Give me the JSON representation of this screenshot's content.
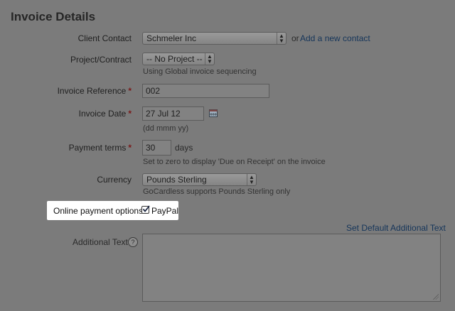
{
  "section": {
    "title": "Invoice Details"
  },
  "client_contact": {
    "label": "Client Contact",
    "value": "Schmeler Inc",
    "or_text": "or",
    "add_link": "Add a new contact"
  },
  "project": {
    "label": "Project/Contract",
    "value": "-- No Project --",
    "hint": "Using Global invoice sequencing"
  },
  "invoice_reference": {
    "label": "Invoice Reference",
    "required_mark": "*",
    "value": "002"
  },
  "invoice_date": {
    "label": "Invoice Date",
    "required_mark": "*",
    "value": "27 Jul 12",
    "hint": "(dd mmm yy)"
  },
  "payment_terms": {
    "label": "Payment terms",
    "required_mark": "*",
    "value": "30",
    "unit": "days",
    "hint": "Set to zero to display 'Due on Receipt' on the invoice"
  },
  "currency": {
    "label": "Currency",
    "value": "Pounds Sterling",
    "hint": "GoCardless supports Pounds Sterling only"
  },
  "online_payment": {
    "label": "Online payment options",
    "option_label": "PayPal",
    "checked": true
  },
  "additional_text": {
    "label": "Additional Text",
    "help_glyph": "?",
    "default_link": "Set Default Additional Text",
    "value": ""
  },
  "icons": {
    "select_arrows": "updown-arrows",
    "calendar": "calendar-icon",
    "check": "checkmark"
  },
  "colors": {
    "highlight_bg": "#ffffff",
    "link": "#15355a",
    "required": "#7a1a1a"
  }
}
